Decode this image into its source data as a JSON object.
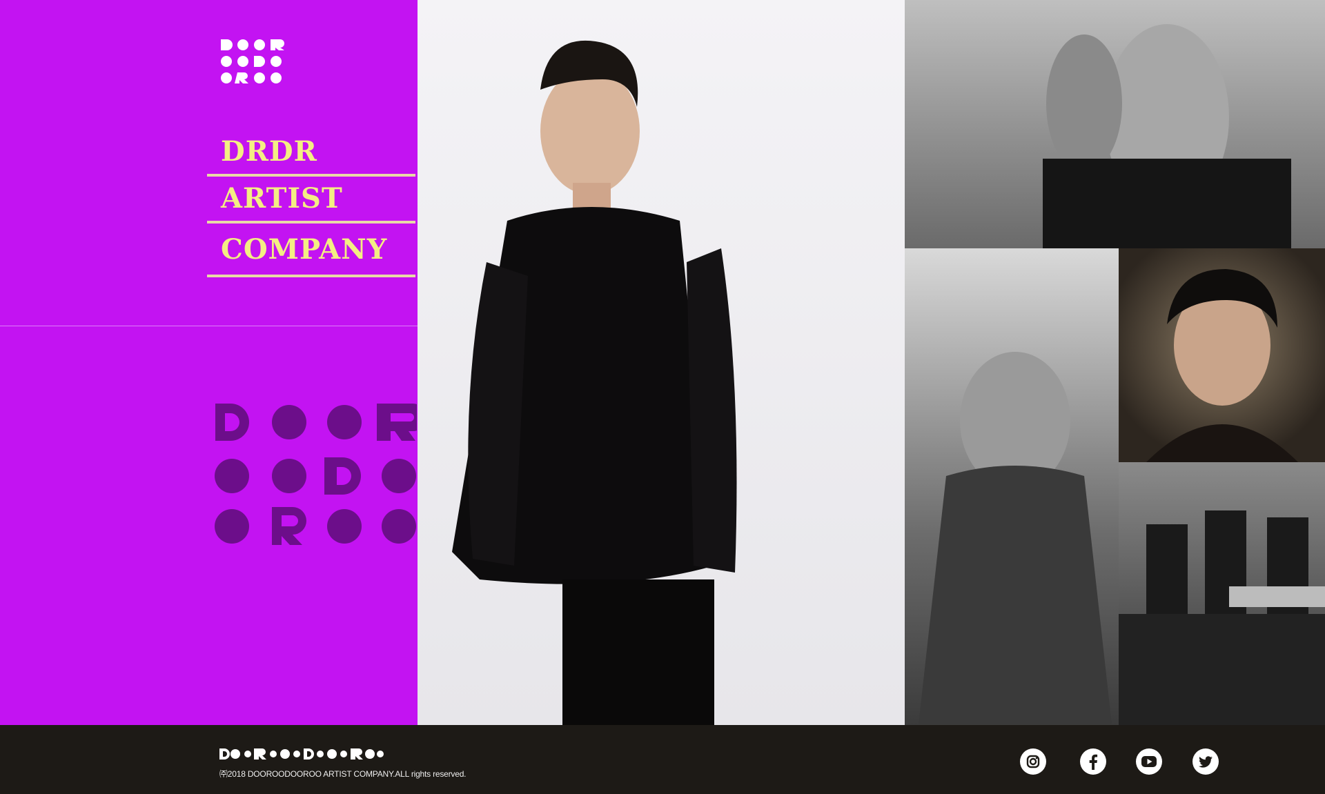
{
  "brand": {
    "logo_small_letters": [
      "D",
      "o",
      "o",
      "R",
      "o",
      "o",
      "D",
      "o",
      "o",
      "R",
      "o",
      "o"
    ],
    "logo_big_letters": [
      "D",
      "o",
      "o",
      "R",
      "o",
      "o",
      "D",
      "o",
      "o",
      "R",
      "o",
      "o"
    ],
    "footer_wordmark": "DoRoDoRo"
  },
  "nav": {
    "items": [
      {
        "label": "DRDR"
      },
      {
        "label": "ARTIST"
      },
      {
        "label": "COMPANY"
      }
    ]
  },
  "footer": {
    "copyright": "㈜2018 DOOROODOOROO ARTIST  COMPANY.ALL rights reserved."
  },
  "social": [
    {
      "icon": "instagram-icon"
    },
    {
      "icon": "facebook-icon"
    },
    {
      "icon": "youtube-icon"
    },
    {
      "icon": "twitter-icon"
    }
  ],
  "colors": {
    "accent": "#c313f2",
    "nav_text": "#f4ee83",
    "nav_rule": "#e9d9a7",
    "logo_dark": "#6c0e8a",
    "footer_bg": "#1d1a16"
  }
}
